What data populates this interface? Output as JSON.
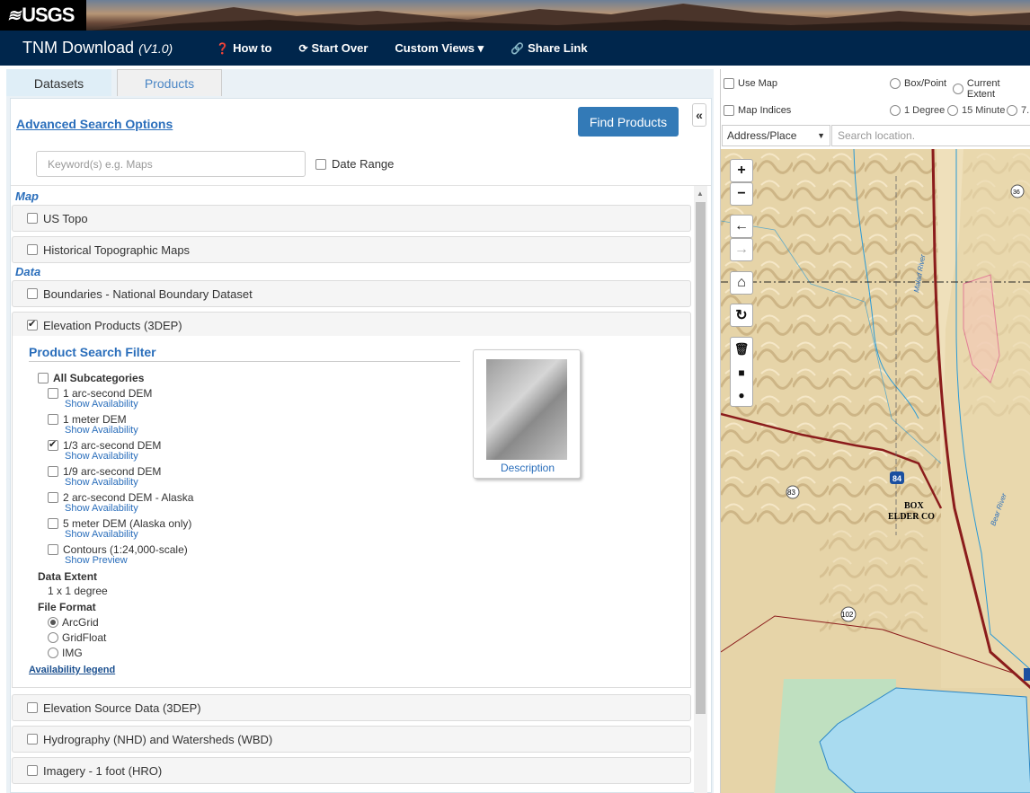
{
  "banner": {
    "logo_text": "USGS"
  },
  "navbar": {
    "title": "TNM Download",
    "version": "(V1.0)",
    "items": [
      {
        "label": "How to",
        "icon": "question-circle-icon"
      },
      {
        "label": "Start Over",
        "icon": "refresh-icon"
      },
      {
        "label": "Custom Views ▾",
        "icon": ""
      },
      {
        "label": "Share Link",
        "icon": "link-icon"
      }
    ]
  },
  "tabs": [
    {
      "label": "Datasets",
      "active": true
    },
    {
      "label": "Products",
      "active": false
    }
  ],
  "search": {
    "advanced_link": "Advanced Search Options",
    "find_button": "Find Products",
    "collapse_label": "«",
    "keyword_placeholder": "Keyword(s) e.g. Maps",
    "date_range_label": "Date Range"
  },
  "sections": {
    "map": "Map",
    "data": "Data"
  },
  "datasets": {
    "us_topo": "US Topo",
    "historical": "Historical Topographic Maps",
    "boundaries": "Boundaries - National Boundary Dataset",
    "elevation": "Elevation Products (3DEP)",
    "elevation_source": "Elevation Source Data (3DEP)",
    "hydrography": "Hydrography (NHD) and Watersheds (WBD)",
    "imagery": "Imagery - 1 foot (HRO)"
  },
  "filter": {
    "title": "Product Search Filter",
    "all_subcategories": "All Subcategories",
    "subcategories": [
      {
        "label": "1 arc-second DEM",
        "link": "Show Availability",
        "checked": false
      },
      {
        "label": "1 meter DEM",
        "link": "Show Availability",
        "checked": false
      },
      {
        "label": "1/3 arc-second DEM",
        "link": "Show Availability",
        "checked": true
      },
      {
        "label": "1/9 arc-second DEM",
        "link": "Show Availability",
        "checked": false
      },
      {
        "label": "2 arc-second DEM - Alaska",
        "link": "Show Availability",
        "checked": false
      },
      {
        "label": "5 meter DEM (Alaska only)",
        "link": "Show Availability",
        "checked": false
      },
      {
        "label": "Contours (1:24,000-scale)",
        "link": "Show Preview",
        "checked": false
      }
    ],
    "data_extent_label": "Data Extent",
    "data_extent_value": "1 x 1 degree",
    "file_format_label": "File Format",
    "formats": [
      {
        "label": "ArcGrid",
        "selected": true
      },
      {
        "label": "GridFloat",
        "selected": false
      },
      {
        "label": "IMG",
        "selected": false
      }
    ],
    "legend_link": "Availability legend",
    "thumbnail_link": "Description"
  },
  "map_controls": {
    "use_map": "Use Map",
    "map_indices": "Map Indices",
    "box_point": "Box/Point",
    "current_extent": "Current Extent",
    "one_degree": "1 Degree",
    "fifteen_minute": "15 Minute",
    "seven_five": "7.",
    "address_select": "Address/Place",
    "search_placeholder": "Search location.",
    "zoom_in": "+",
    "zoom_out": "−"
  },
  "map_labels": {
    "county_line1": "BOX",
    "county_line2": "ELDER CO",
    "interstate": "84",
    "route_83": "83",
    "route_102": "102",
    "route_36": "36",
    "river": "Malad River",
    "river2": "Bear River"
  },
  "colors": {
    "navbar": "#00264c",
    "accent": "#337ab7",
    "link": "#2a6ebb"
  }
}
